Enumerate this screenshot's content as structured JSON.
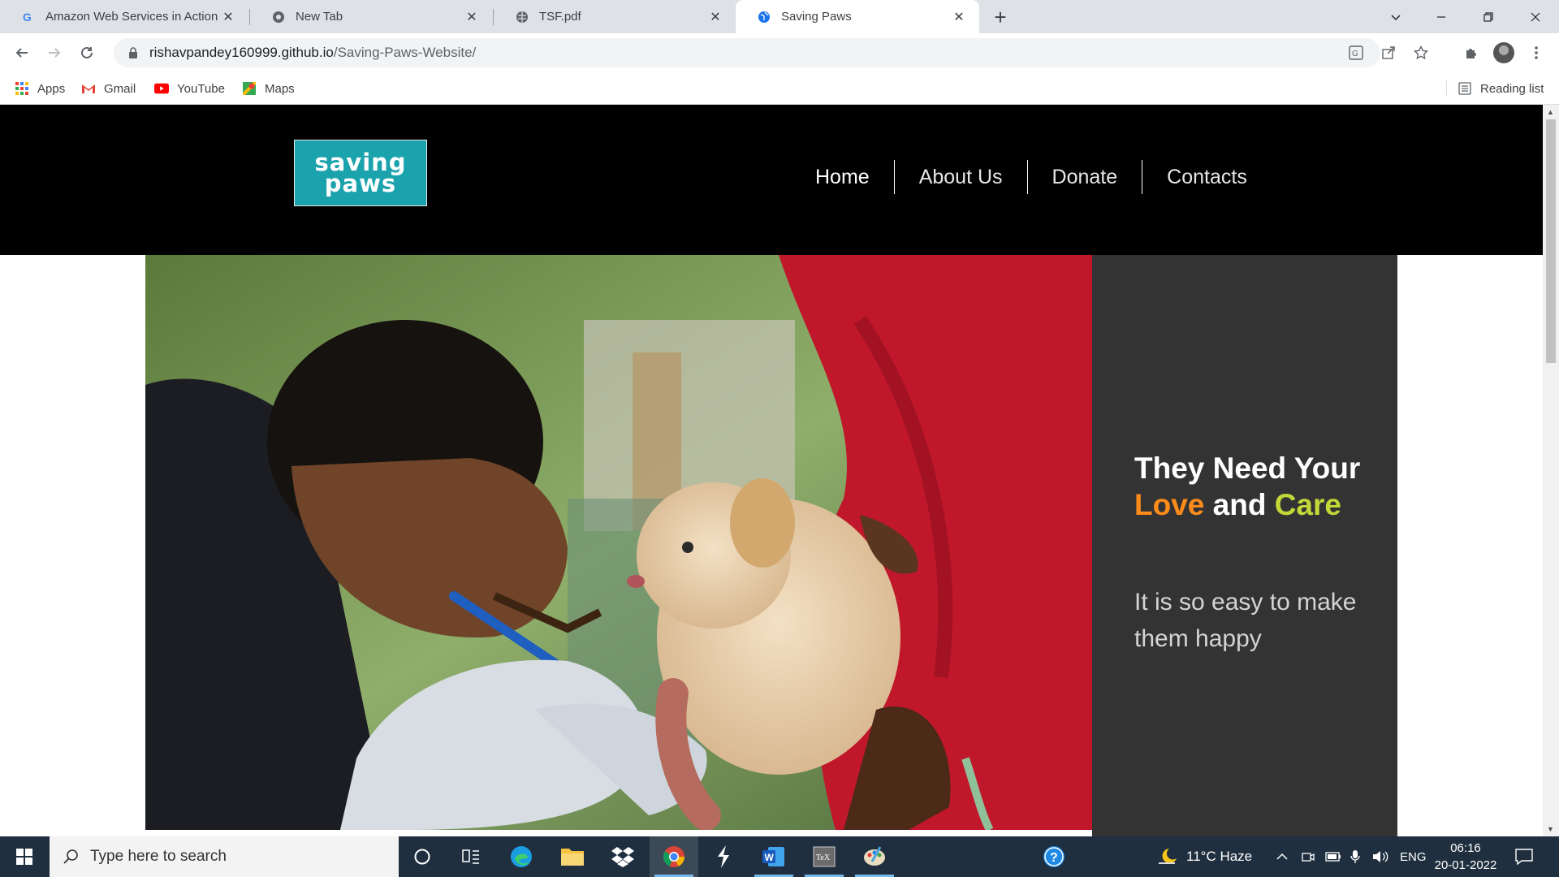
{
  "browser": {
    "tabs": [
      {
        "title": "Amazon Web Services in Action -",
        "icon": "google-icon",
        "active": false
      },
      {
        "title": "New Tab",
        "icon": "chrome-icon",
        "active": false
      },
      {
        "title": "TSF.pdf",
        "icon": "globe-icon",
        "active": false
      },
      {
        "title": "Saving Paws",
        "icon": "globe-icon",
        "active": true
      }
    ],
    "url_host": "rishavpandey160999.github.io",
    "url_path": "/Saving-Paws-Website/",
    "bookmarks": [
      {
        "label": "Apps",
        "icon": "apps-grid-icon"
      },
      {
        "label": "Gmail",
        "icon": "gmail-icon"
      },
      {
        "label": "YouTube",
        "icon": "youtube-icon"
      },
      {
        "label": "Maps",
        "icon": "maps-icon"
      }
    ],
    "reading_list": "Reading list"
  },
  "site": {
    "logo_line1": "saving",
    "logo_line2": "paws",
    "nav": [
      "Home",
      "About Us",
      "Donate",
      "Contacts"
    ],
    "hero": {
      "heading_part1": "They Need Your ",
      "heading_love": "Love",
      "heading_part2": " and ",
      "heading_care": "Care",
      "subtext": "It is so easy to make them happy"
    },
    "colors": {
      "header_bg": "#000000",
      "panel_bg": "#333333",
      "love": "#ff8c1a",
      "care": "#c3d838",
      "logo_bg": "#1ba3ad"
    }
  },
  "taskbar": {
    "search_placeholder": "Type here to search",
    "weather": "11°C  Haze",
    "language": "ENG",
    "time": "06:16",
    "date": "20-01-2022"
  }
}
